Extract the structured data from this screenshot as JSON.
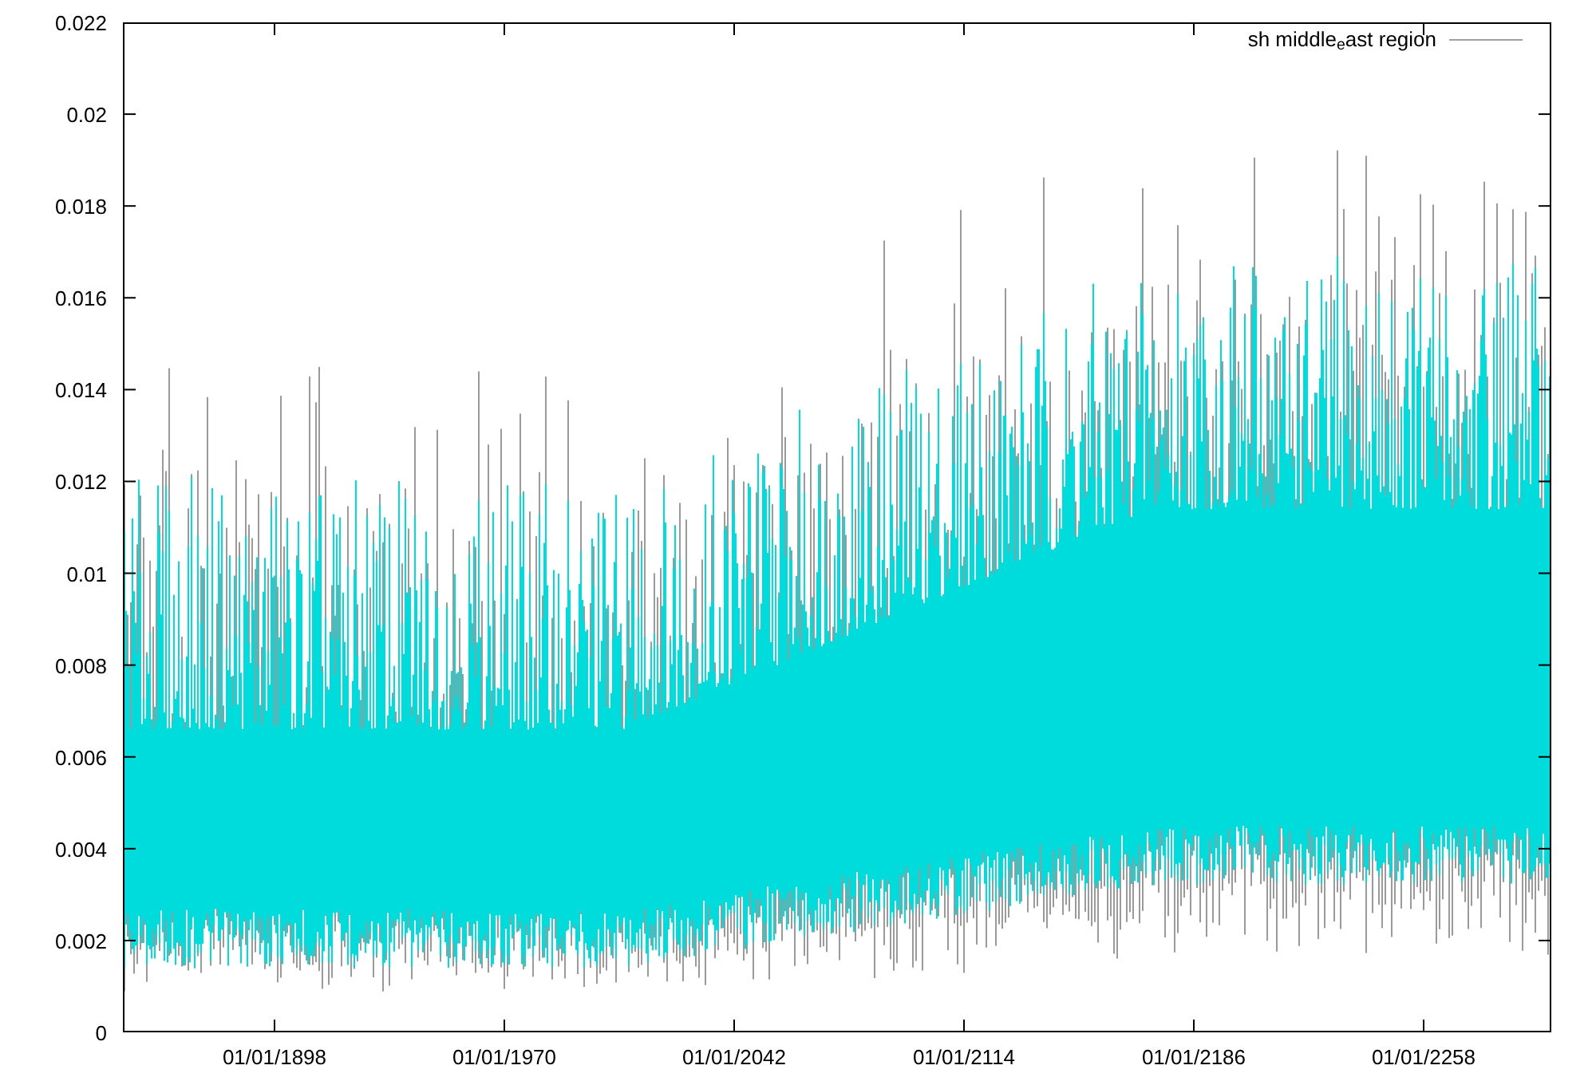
{
  "chart": {
    "legend": {
      "label": "sh middle$_{e}$ast region"
    },
    "y_ticks": [
      "0.022",
      "0.02",
      "0.018",
      "0.016",
      "0.014",
      "0.012",
      "0.01",
      "0.008",
      "0.006",
      "0.004",
      "0.002",
      "0"
    ],
    "x_ticks": [
      "01/01/1898",
      "01/01/1970",
      "01/01/2042",
      "01/01/2114",
      "01/01/2186",
      "01/01/2258"
    ]
  }
}
